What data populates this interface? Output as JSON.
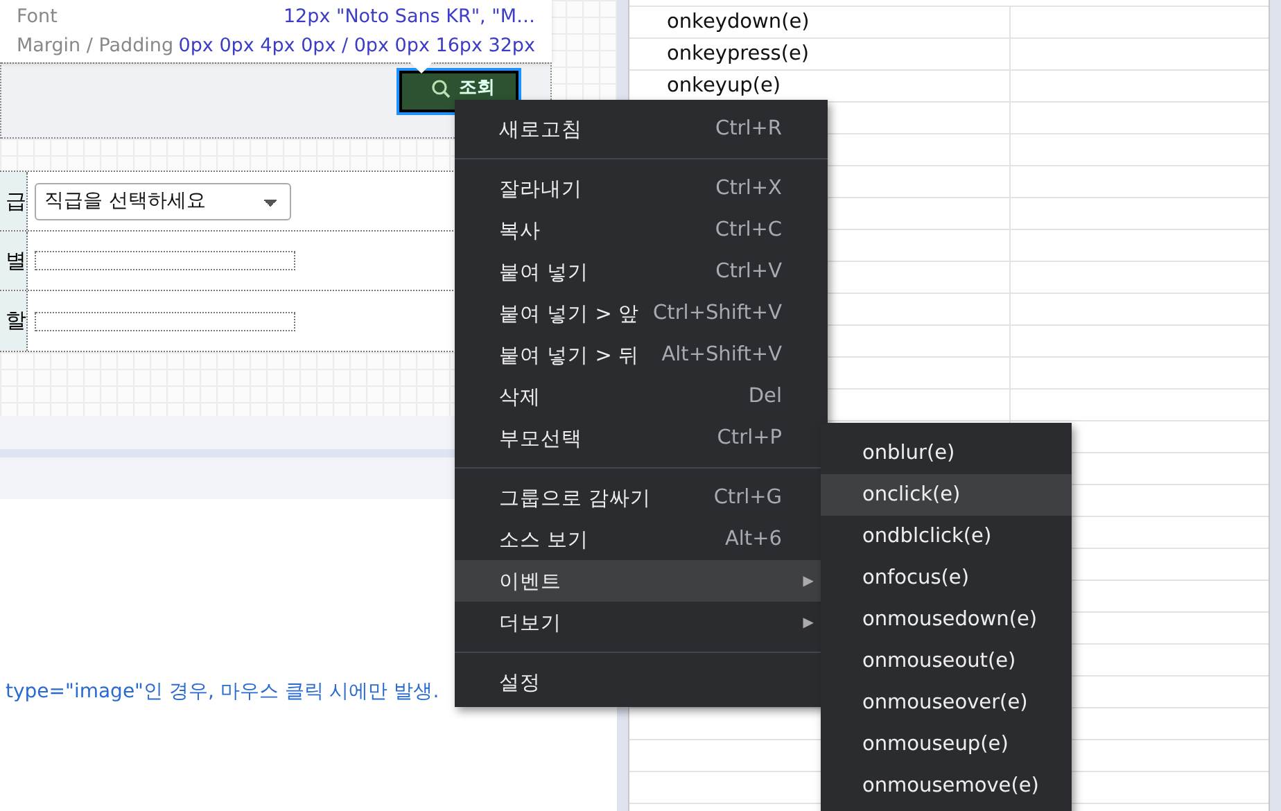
{
  "tooltip": {
    "rows": [
      {
        "label": "Font",
        "value": "12px \"Noto Sans KR\", \"M…"
      },
      {
        "label": "Margin / Padding",
        "value": "0px 0px 4px 0px / 0px 0px 16px 32px"
      }
    ]
  },
  "search_button": {
    "label": "조회"
  },
  "form": {
    "rows": [
      {
        "label": "급",
        "kind": "select",
        "value": "직급을 선택하세요"
      },
      {
        "label": "별",
        "kind": "input"
      },
      {
        "label": "할",
        "kind": "input"
      }
    ]
  },
  "description": "type=\"image\"인 경우, 마우스 클릭 시에만 발생.",
  "event_table": {
    "rows": [
      "onkeydown(e)",
      "onkeypress(e)",
      "onkeyup(e)"
    ]
  },
  "context_menu": {
    "items": [
      {
        "kind": "item",
        "label": "새로고침",
        "shortcut": "Ctrl+R",
        "selected": false
      },
      {
        "kind": "separator"
      },
      {
        "kind": "item",
        "label": "잘라내기",
        "shortcut": "Ctrl+X",
        "selected": false
      },
      {
        "kind": "item",
        "label": "복사",
        "shortcut": "Ctrl+C",
        "selected": false
      },
      {
        "kind": "item",
        "label": "붙여 넣기",
        "shortcut": "Ctrl+V",
        "selected": false
      },
      {
        "kind": "item",
        "label": "붙여 넣기 > 앞",
        "shortcut": "Ctrl+Shift+V",
        "selected": false
      },
      {
        "kind": "item",
        "label": "붙여 넣기 > 뒤",
        "shortcut": "Alt+Shift+V",
        "selected": false
      },
      {
        "kind": "item",
        "label": "삭제",
        "shortcut": "Del",
        "selected": false
      },
      {
        "kind": "item",
        "label": "부모선택",
        "shortcut": "Ctrl+P",
        "selected": false
      },
      {
        "kind": "separator"
      },
      {
        "kind": "item",
        "label": "그룹으로 감싸기",
        "shortcut": "Ctrl+G",
        "selected": false
      },
      {
        "kind": "item",
        "label": "소스 보기",
        "shortcut": "Alt+6",
        "selected": false
      },
      {
        "kind": "submenu",
        "label": "이벤트",
        "arrow": "▶",
        "selected": true
      },
      {
        "kind": "submenu",
        "label": "더보기",
        "arrow": "▶",
        "selected": false
      },
      {
        "kind": "separator"
      },
      {
        "kind": "item",
        "label": "설정",
        "selected": false
      }
    ]
  },
  "submenu": {
    "items": [
      {
        "label": "onblur(e)",
        "selected": false
      },
      {
        "label": "onclick(e)",
        "selected": true
      },
      {
        "label": "ondblclick(e)",
        "selected": false
      },
      {
        "label": "onfocus(e)",
        "selected": false
      },
      {
        "label": "onmousedown(e)",
        "selected": false
      },
      {
        "label": "onmouseout(e)",
        "selected": false
      },
      {
        "label": "onmouseover(e)",
        "selected": false
      },
      {
        "label": "onmouseup(e)",
        "selected": false
      },
      {
        "label": "onmousemove(e)",
        "selected": false
      }
    ]
  }
}
